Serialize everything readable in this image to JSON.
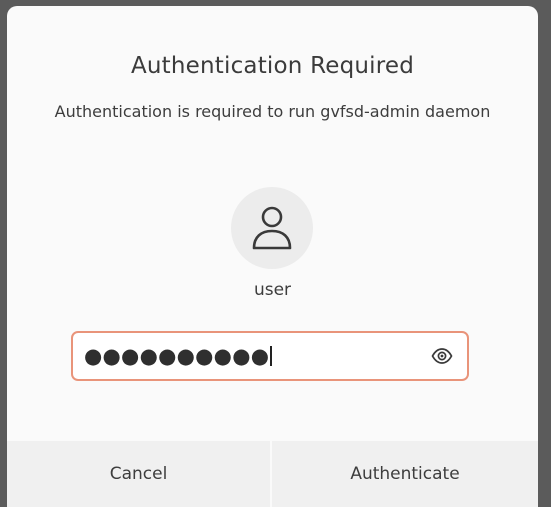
{
  "dialog": {
    "title": "Authentication Required",
    "message": "Authentication is required to run gvfsd-admin daemon",
    "username": "user",
    "password_masked": "●●●●●●●●●●",
    "cancel_label": "Cancel",
    "authenticate_label": "Authenticate",
    "icons": {
      "avatar": "user-icon",
      "reveal": "eye-icon"
    },
    "colors": {
      "focus_border": "#e9947a"
    }
  }
}
